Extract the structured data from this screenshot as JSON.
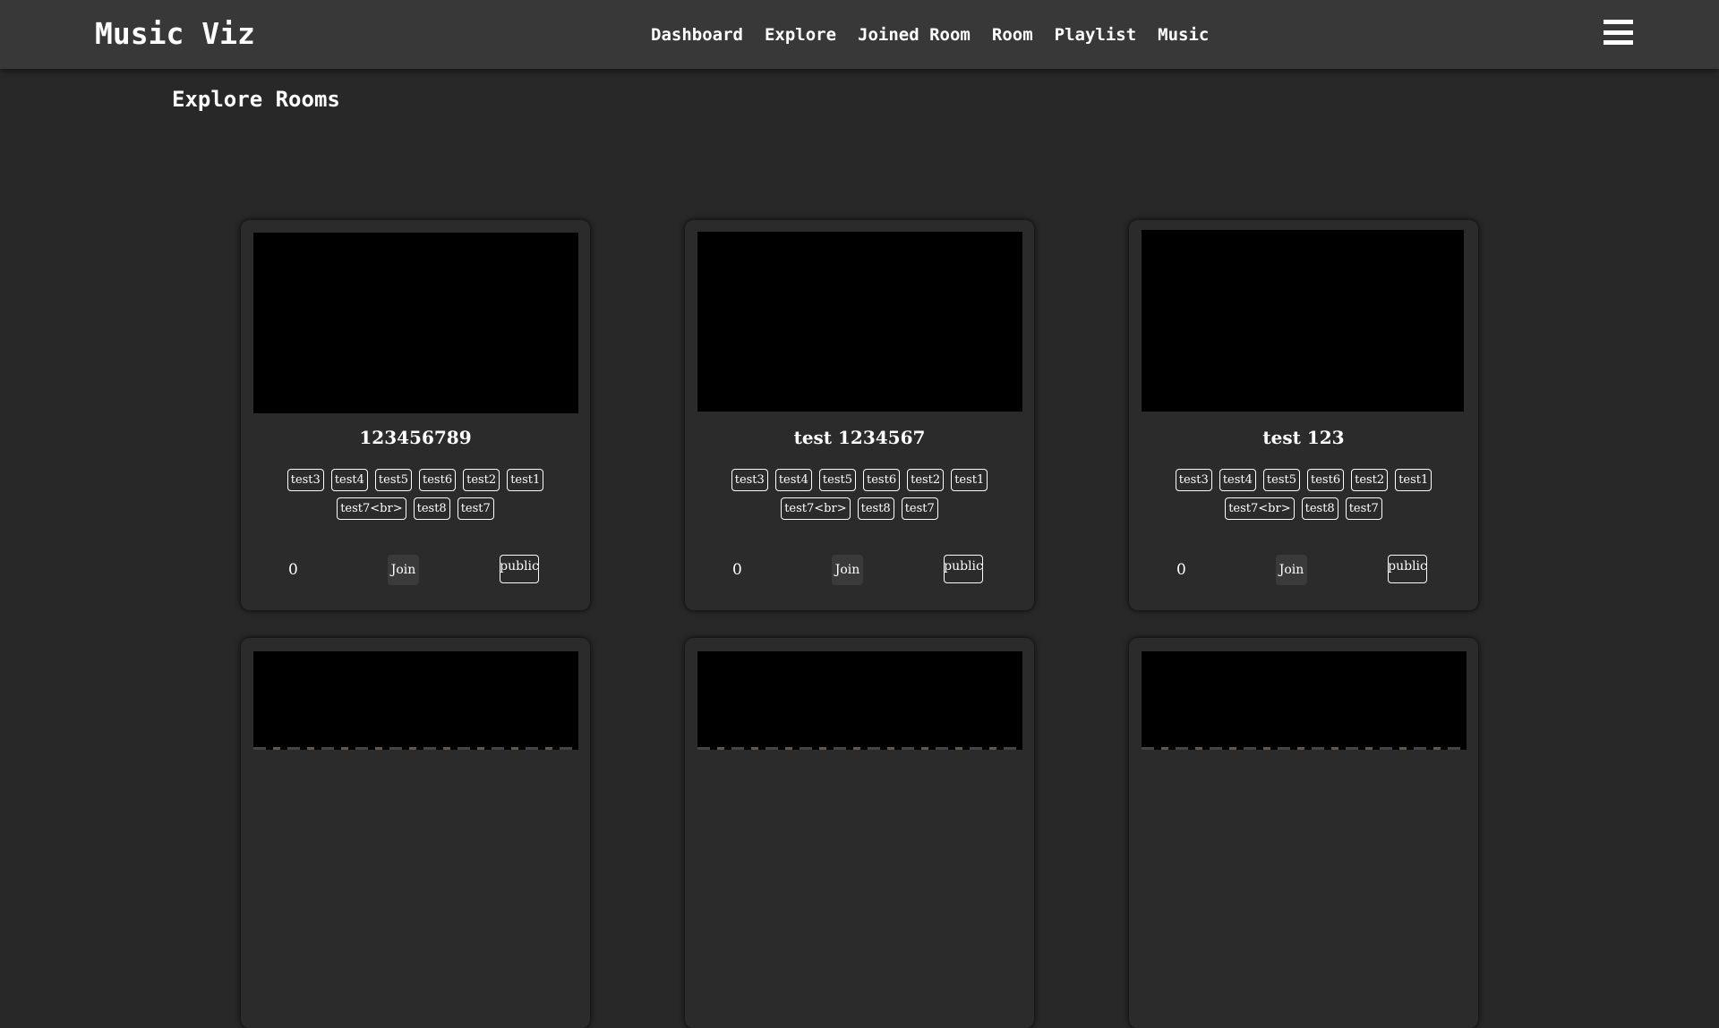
{
  "app": {
    "title": "Music Viz"
  },
  "nav": {
    "items": [
      {
        "label": "Dashboard"
      },
      {
        "label": "Explore"
      },
      {
        "label": "Joined Room"
      },
      {
        "label": "Room"
      },
      {
        "label": "Playlist"
      },
      {
        "label": "Music"
      }
    ],
    "menu_icon": "hamburger-menu-icon"
  },
  "page": {
    "title": "Explore Rooms"
  },
  "rooms": [
    {
      "name": "123456789",
      "tags": [
        "test3",
        "test4",
        "test5",
        "test6",
        "test2",
        "test1",
        "test7<br>",
        "test8",
        "test7"
      ],
      "count": "0",
      "join_label": "Join",
      "visibility": "public"
    },
    {
      "name": "test 1234567",
      "tags": [
        "test3",
        "test4",
        "test5",
        "test6",
        "test2",
        "test1",
        "test7<br>",
        "test8",
        "test7"
      ],
      "count": "0",
      "join_label": "Join",
      "visibility": "public"
    },
    {
      "name": "test 123",
      "tags": [
        "test3",
        "test4",
        "test5",
        "test6",
        "test2",
        "test1",
        "test7<br>",
        "test8",
        "test7"
      ],
      "count": "0",
      "join_label": "Join",
      "visibility": "public"
    }
  ],
  "colors": {
    "background": "#282828",
    "navbar": "#383838",
    "card": "#2b2b2b",
    "artwork": "#000000",
    "text": "#ffffff"
  }
}
